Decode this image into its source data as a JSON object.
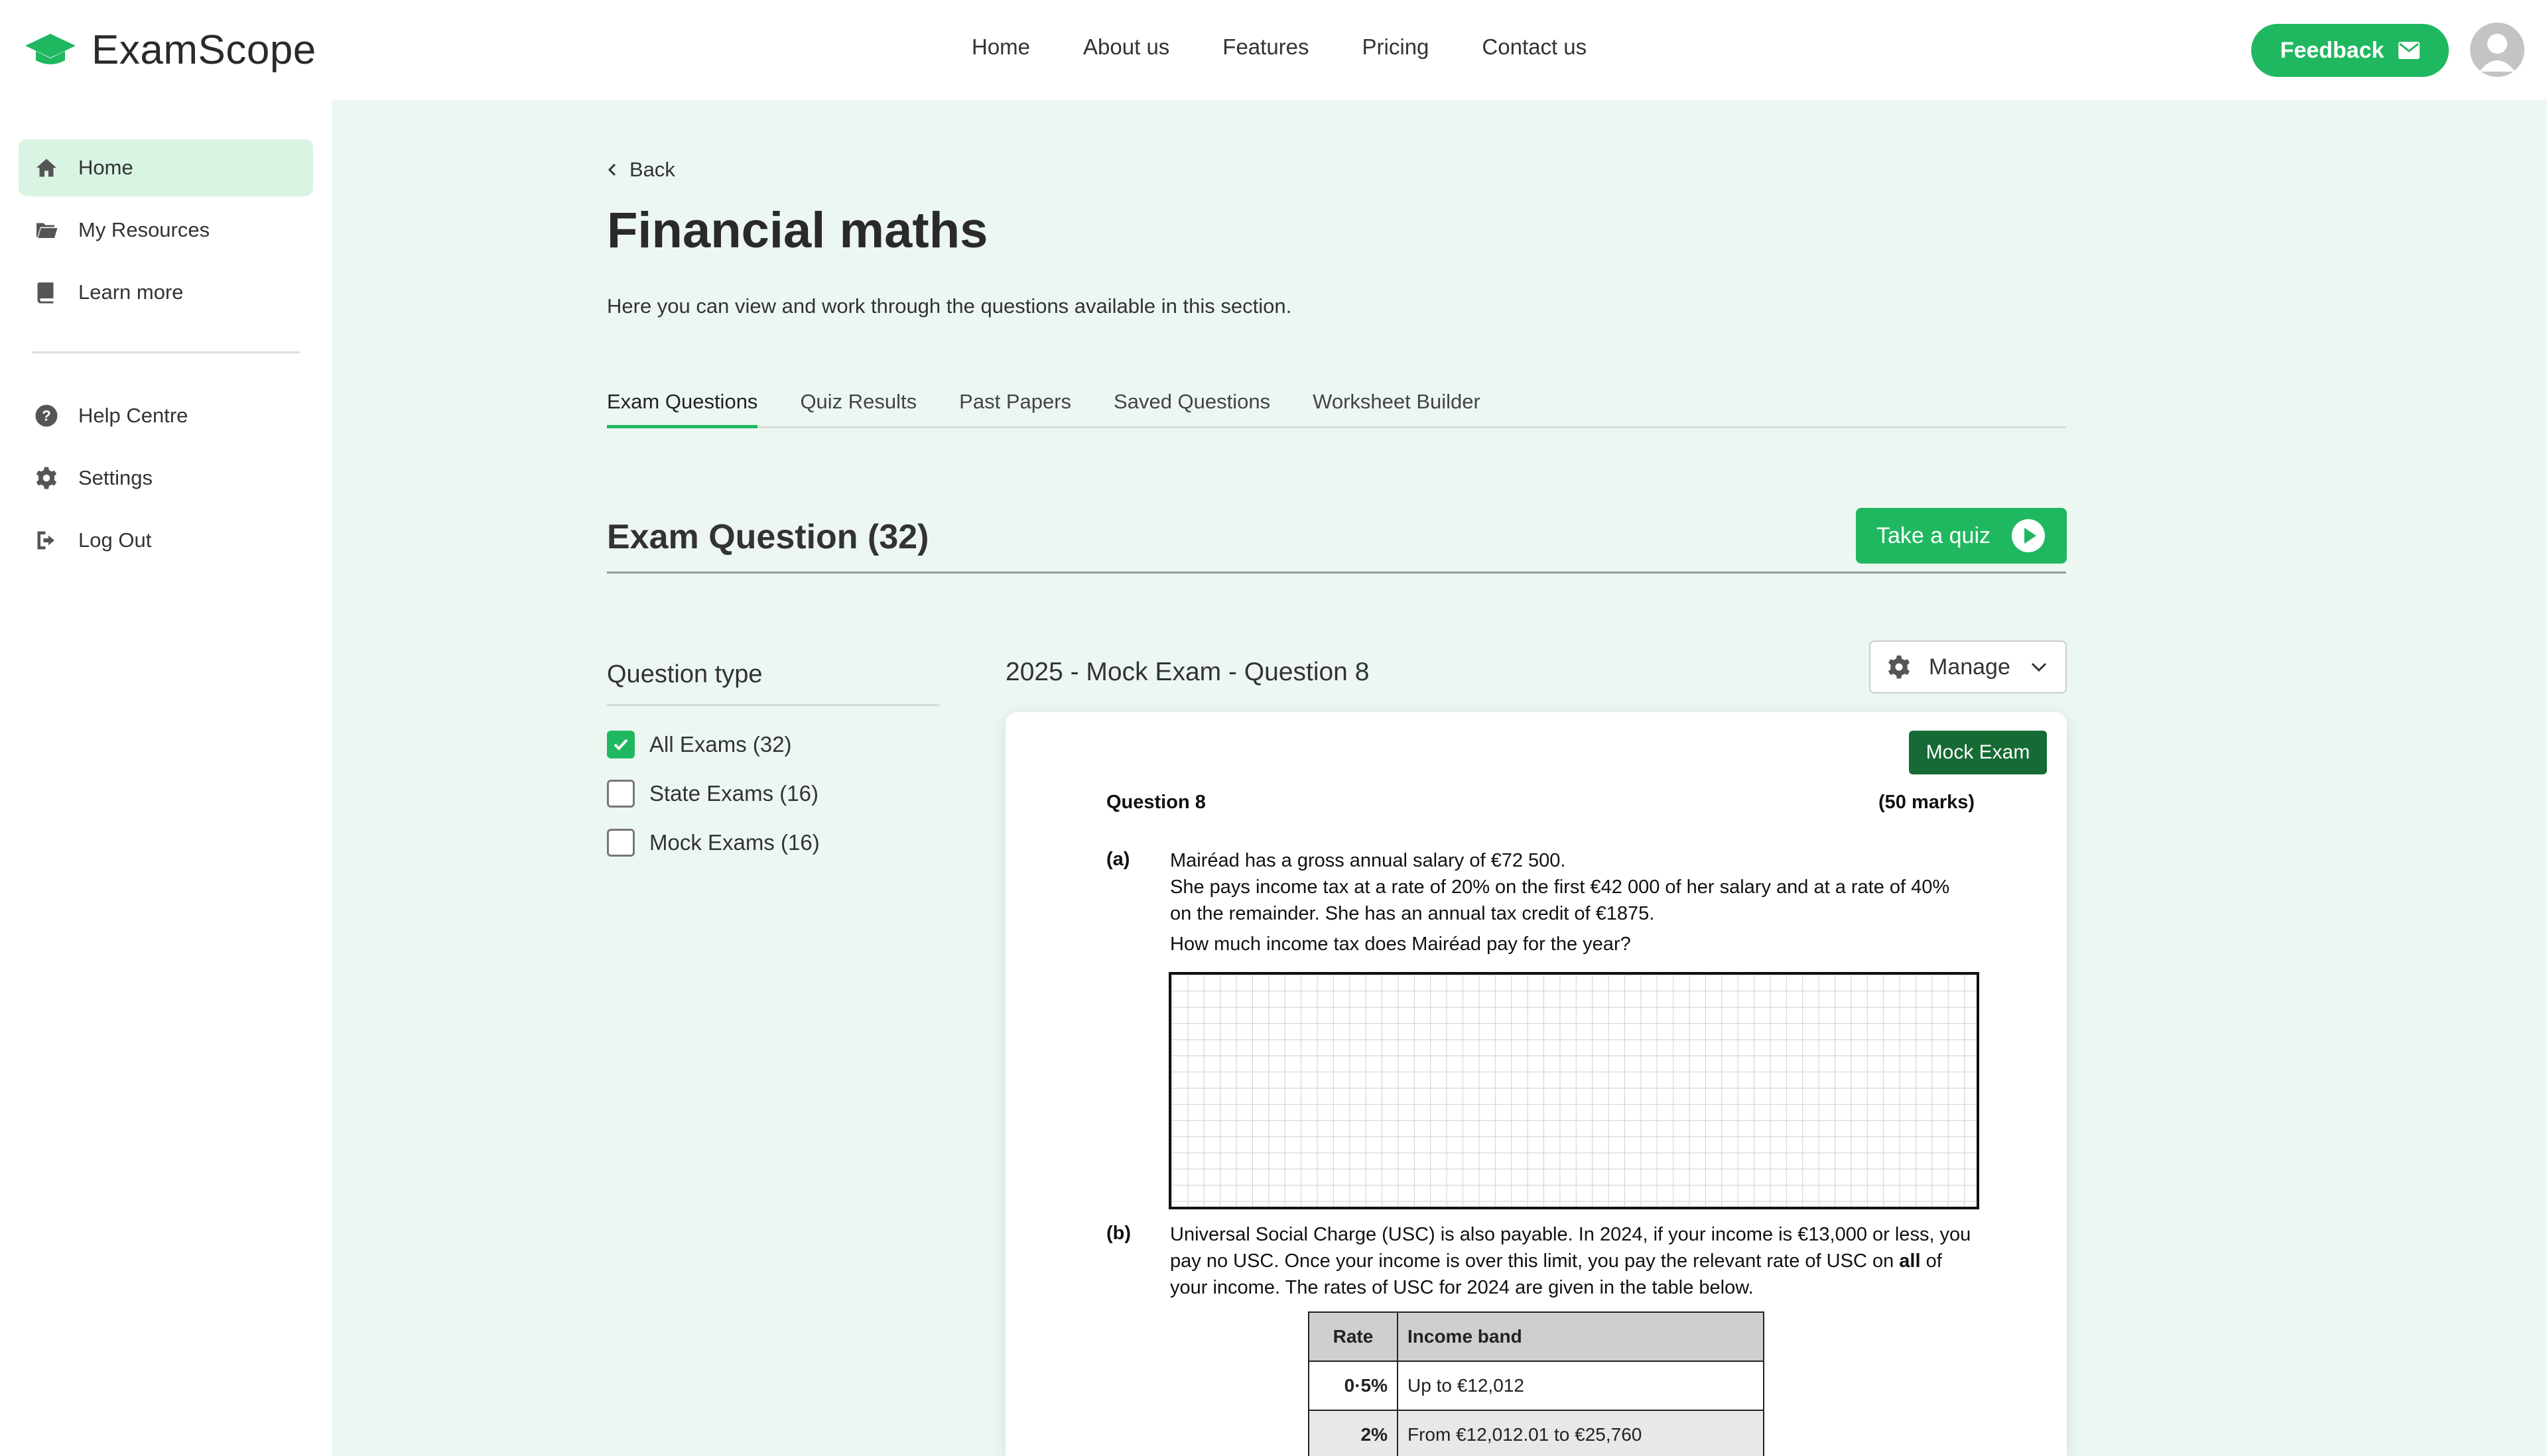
{
  "app": {
    "name": "ExamScope"
  },
  "nav": {
    "items": [
      "Home",
      "About us",
      "Features",
      "Pricing",
      "Contact us"
    ]
  },
  "header": {
    "feedback_label": "Feedback"
  },
  "sidebar": {
    "items": [
      {
        "label": "Home",
        "icon": "home-icon",
        "active": true
      },
      {
        "label": "My Resources",
        "icon": "folder-icon"
      },
      {
        "label": "Learn more",
        "icon": "book-icon"
      }
    ],
    "bottom_items": [
      {
        "label": "Help Centre",
        "icon": "help-icon"
      },
      {
        "label": "Settings",
        "icon": "gear-icon"
      },
      {
        "label": "Log Out",
        "icon": "logout-icon"
      }
    ]
  },
  "main": {
    "back_label": "Back",
    "title": "Financial maths",
    "description": "Here you can view and work through the questions available in this section.",
    "tabs": [
      {
        "label": "Exam Questions",
        "active": true
      },
      {
        "label": "Quiz Results"
      },
      {
        "label": "Past Papers"
      },
      {
        "label": "Saved Questions"
      },
      {
        "label": "Worksheet Builder"
      }
    ],
    "section_title": "Exam Question (32)",
    "quiz_button": "Take a quiz"
  },
  "filters": {
    "title": "Question type",
    "options": [
      {
        "label": "All Exams (32)",
        "checked": true
      },
      {
        "label": "State Exams (16)",
        "checked": false
      },
      {
        "label": "Mock Exams (16)",
        "checked": false
      }
    ]
  },
  "question": {
    "header": "2025 - Mock Exam - Question 8",
    "manage_label": "Manage",
    "badge": "Mock Exam",
    "number": "Question 8",
    "marks": "(50 marks)",
    "part_a_label": "(a)",
    "part_a_line1": "Mairéad has a gross annual salary of €72 500.",
    "part_a_line2": "She pays income tax at a rate of 20% on the first €42 000 of her salary and at a rate of 40%",
    "part_a_line3": "on the remainder. She has an annual tax credit of €1875.",
    "part_a_ask": "How much income tax does Mairéad pay for the year?",
    "part_b_label": "(b)",
    "part_b_line1": "Universal Social Charge (USC) is also payable. In 2024, if your income is €13,000 or less, you",
    "part_b_line2a": "pay no USC. Once your income is over this limit, you pay the relevant rate of USC on ",
    "part_b_bold": "all",
    "part_b_line2b": " of",
    "part_b_line3": "your income. The rates of USC for 2024 are given in the table below.",
    "table": {
      "headers": [
        "Rate",
        "Income band"
      ],
      "rows": [
        [
          "0·5%",
          "Up to €12,012"
        ],
        [
          "2%",
          "From €12,012.01 to €25,760"
        ]
      ]
    }
  },
  "colors": {
    "accent": "#1fb860",
    "badge": "#166b34",
    "background": "#edf7f1"
  }
}
